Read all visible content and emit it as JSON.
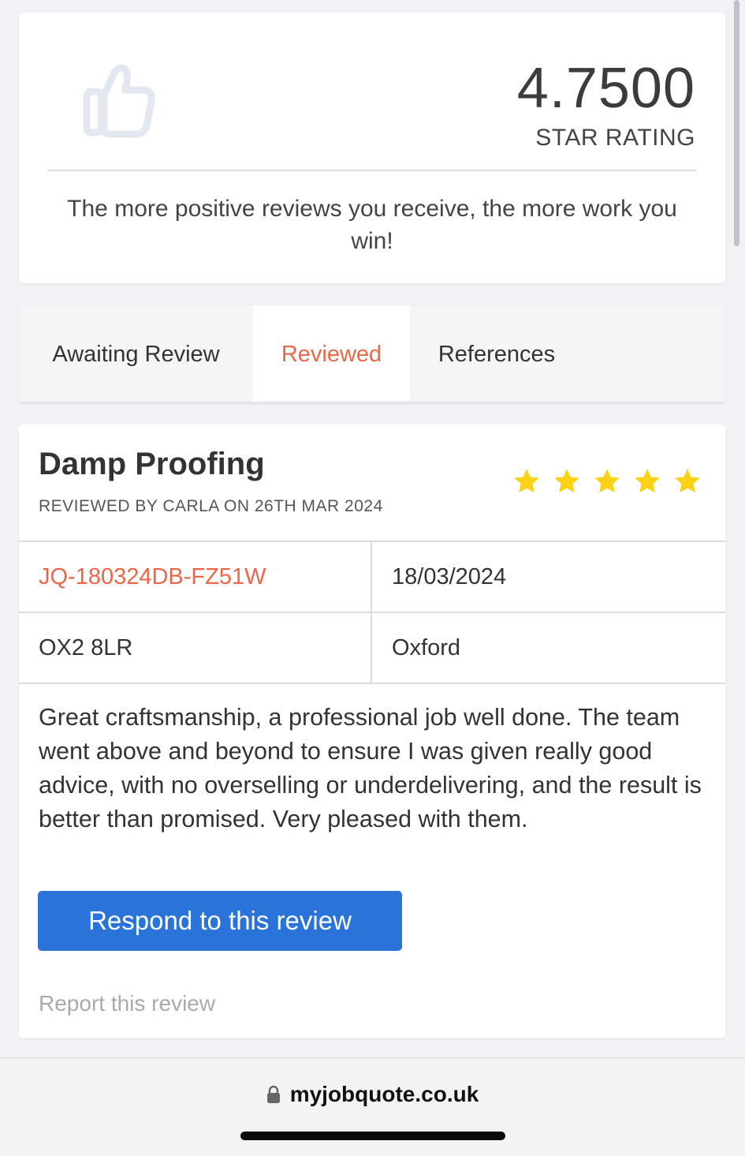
{
  "rating": {
    "value": "4.7500",
    "label": "STAR RATING",
    "message": "The more positive reviews you receive, the more work you win!"
  },
  "tabs": [
    {
      "label": "Awaiting Review",
      "active": false
    },
    {
      "label": "Reviewed",
      "active": true
    },
    {
      "label": "References",
      "active": false
    }
  ],
  "review": {
    "title": "Damp Proofing",
    "meta": "REVIEWED BY CARLA ON 26TH MAR 2024",
    "stars": 5,
    "job_id": "JQ-180324DB-FZ51W",
    "date": "18/03/2024",
    "postcode": "OX2 8LR",
    "town": "Oxford",
    "text": "Great craftsmanship, a professional job well done. The team went above and beyond to ensure I was given really good advice, with no overselling or underdelivering, and the result is better than promised. Very pleased with them.",
    "respond_label": "Respond to this review",
    "report_label": "Report this review"
  },
  "browser": {
    "url": "myjobquote.co.uk"
  },
  "colors": {
    "accent": "#e8674a",
    "button": "#2a73d9",
    "star": "#fcd116"
  },
  "icons": {
    "rating": "thumbs-up-icon",
    "star": "star-icon",
    "lock": "lock-icon"
  }
}
